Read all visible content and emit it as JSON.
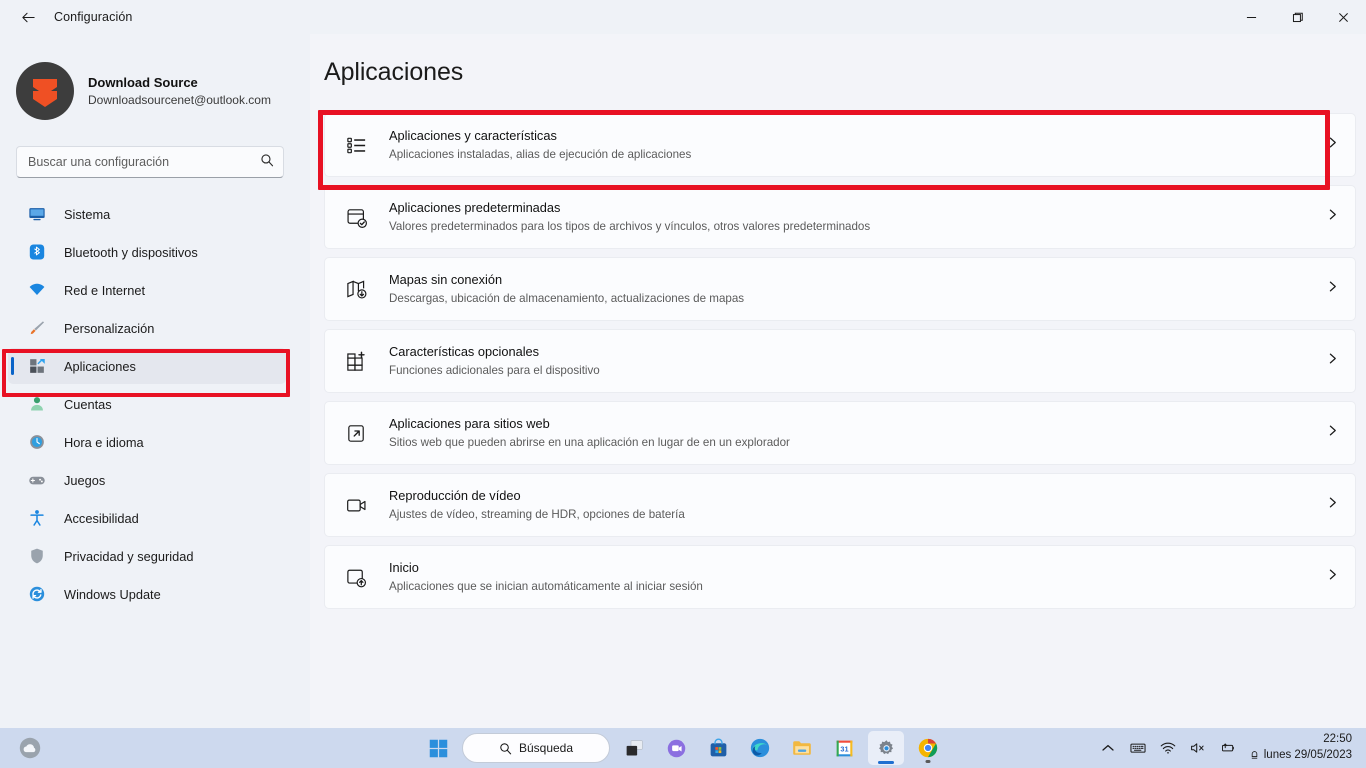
{
  "window": {
    "title": "Configuración",
    "back_icon": "back-arrow-icon",
    "minimize_label": "Minimizar",
    "maximize_label": "Maximizar",
    "close_label": "Cerrar"
  },
  "profile": {
    "name": "Download Source",
    "email": "Downloadsourcenet@outlook.com",
    "avatar_icon": "double-chevron-down-avatar"
  },
  "search": {
    "placeholder": "Buscar una configuración",
    "value": "",
    "icon": "search-icon"
  },
  "sidebar": {
    "items": [
      {
        "label": "Sistema",
        "icon": "monitor-icon",
        "active": false
      },
      {
        "label": "Bluetooth y dispositivos",
        "icon": "bluetooth-icon",
        "active": false
      },
      {
        "label": "Red e Internet",
        "icon": "wifi-icon",
        "active": false
      },
      {
        "label": "Personalización",
        "icon": "paintbrush-icon",
        "active": false
      },
      {
        "label": "Aplicaciones",
        "icon": "apps-grid-icon",
        "active": true
      },
      {
        "label": "Cuentas",
        "icon": "person-icon",
        "active": false
      },
      {
        "label": "Hora e idioma",
        "icon": "clock-icon",
        "active": false
      },
      {
        "label": "Juegos",
        "icon": "gamepad-icon",
        "active": false
      },
      {
        "label": "Accesibilidad",
        "icon": "accessibility-icon",
        "active": false
      },
      {
        "label": "Privacidad y seguridad",
        "icon": "shield-icon",
        "active": false
      },
      {
        "label": "Windows Update",
        "icon": "update-refresh-icon",
        "active": false
      }
    ]
  },
  "main": {
    "page_title": "Aplicaciones",
    "cards": [
      {
        "title": "Aplicaciones y características",
        "subtitle": "Aplicaciones instaladas, alias de ejecución de aplicaciones",
        "icon": "list-bullets-icon",
        "highlighted": true
      },
      {
        "title": "Aplicaciones predeterminadas",
        "subtitle": "Valores predeterminados para los tipos de archivos y vínculos, otros valores predeterminados",
        "icon": "default-apps-check-icon",
        "highlighted": false
      },
      {
        "title": "Mapas sin conexión",
        "subtitle": "Descargas, ubicación de almacenamiento, actualizaciones de mapas",
        "icon": "map-download-icon",
        "highlighted": false
      },
      {
        "title": "Características opcionales",
        "subtitle": "Funciones adicionales para el dispositivo",
        "icon": "grid-plus-icon",
        "highlighted": false
      },
      {
        "title": "Aplicaciones para sitios web",
        "subtitle": "Sitios web que pueden abrirse en una aplicación en lugar de en un explorador",
        "icon": "external-link-icon",
        "highlighted": false
      },
      {
        "title": "Reproducción de vídeo",
        "subtitle": "Ajustes de vídeo, streaming de HDR, opciones de batería",
        "icon": "video-camera-icon",
        "highlighted": false
      },
      {
        "title": "Inicio",
        "subtitle": "Aplicaciones que se inician automáticamente al iniciar sesión",
        "icon": "startup-arrow-icon",
        "highlighted": false
      }
    ],
    "chevron_icon": "chevron-right-icon"
  },
  "taskbar": {
    "weather_icon": "weather-cloud-sun-icon",
    "search": {
      "label": "Búsqueda",
      "icon": "search-icon"
    },
    "buttons": [
      {
        "name": "start-button",
        "icon": "windows-logo-icon",
        "state": "idle"
      },
      {
        "name": "task-view-button",
        "icon": "task-view-icon",
        "state": "idle"
      },
      {
        "name": "chat-button",
        "icon": "chat-video-icon",
        "state": "idle"
      },
      {
        "name": "microsoft-store-button",
        "icon": "store-bag-icon",
        "state": "idle"
      },
      {
        "name": "edge-button",
        "icon": "edge-browser-icon",
        "state": "idle"
      },
      {
        "name": "file-explorer-button",
        "icon": "folder-icon",
        "state": "idle"
      },
      {
        "name": "calendar-button",
        "icon": "calendar-31-icon",
        "state": "idle"
      },
      {
        "name": "settings-button",
        "icon": "gear-icon",
        "state": "active"
      },
      {
        "name": "chrome-button",
        "icon": "chrome-browser-icon",
        "state": "running"
      }
    ],
    "tray": {
      "overflow_icon": "chevron-up-icon",
      "keyboard_icon": "keyboard-icon",
      "wifi_icon": "wifi-icon",
      "volume_icon": "volume-muted-icon",
      "battery_icon": "battery-charging-icon",
      "notification_icon": "notification-bell-icon"
    },
    "clock": {
      "time": "22:50",
      "date": "lunes 29/05/2023"
    }
  },
  "colors": {
    "page_background": "#f3f4f9",
    "sidebar_background": "#eff2f7",
    "card_background": "#fbfcfe",
    "accent": "#0a64c8",
    "annotation_red": "#e81123",
    "taskbar": "#cdd9ee"
  }
}
